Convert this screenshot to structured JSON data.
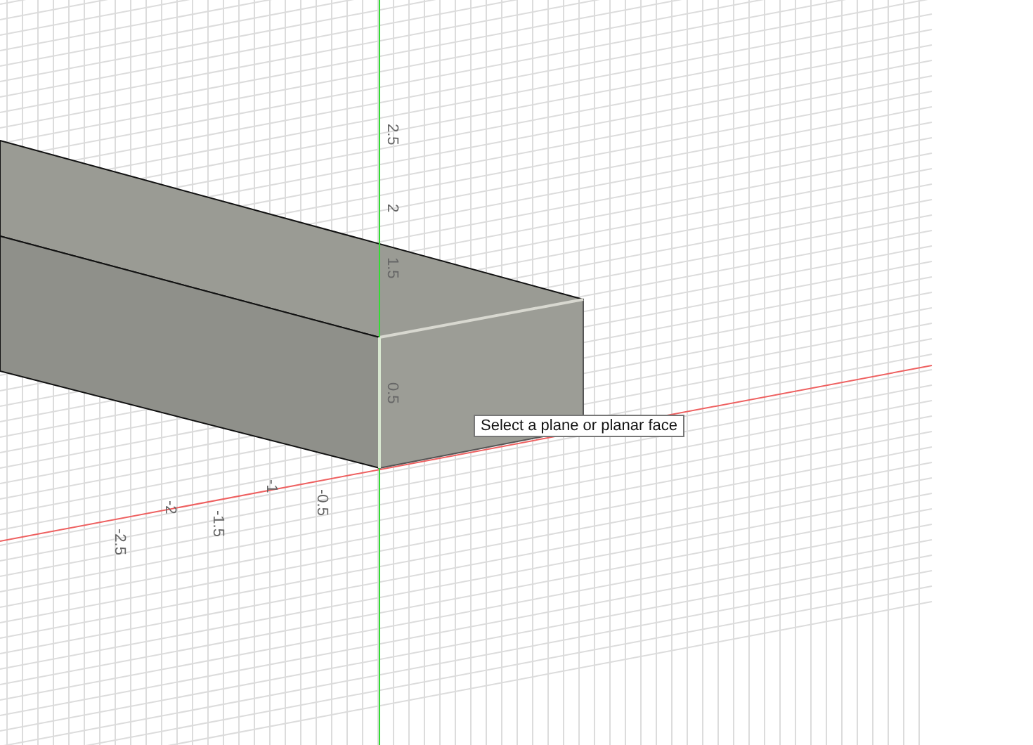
{
  "viewport": {
    "vertical_axis_labels": [
      "2.5",
      "2",
      "1.5",
      "0.5"
    ],
    "horizontal_axis_labels": [
      "-0.5",
      "-1",
      "-1.5",
      "-2",
      "-2.5"
    ],
    "tooltip": "Select a plane or planar face"
  }
}
